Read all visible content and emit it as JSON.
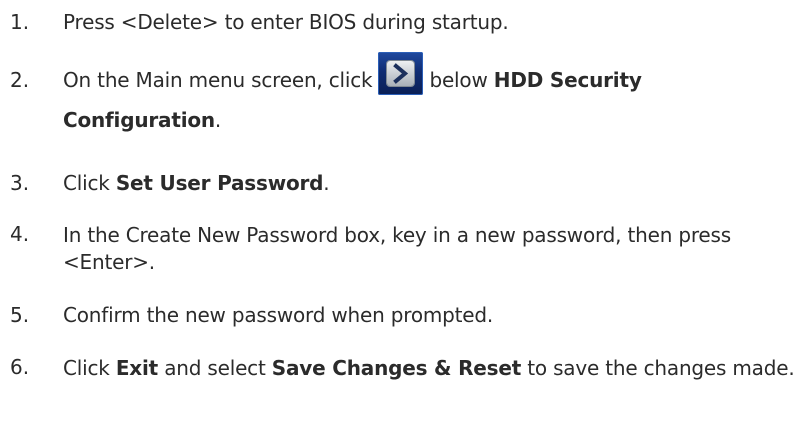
{
  "steps": [
    {
      "number": "1.",
      "parts": [
        "Press <Delete> to enter BIOS during startup."
      ]
    },
    {
      "number": "2.",
      "parts": [
        "On the Main menu screen, click",
        "below",
        "HDD Security Configuration",
        "."
      ],
      "icon": "arrow-right-icon"
    },
    {
      "number": "3.",
      "parts": [
        "Click",
        "Set User Password",
        "."
      ]
    },
    {
      "number": "4.",
      "parts": [
        "In the Create New Password box, key in a new password, then press <Enter>."
      ]
    },
    {
      "number": "5.",
      "parts": [
        "Confirm the new password when prompted."
      ]
    },
    {
      "number": "6.",
      "parts": [
        "Click",
        "Exit",
        "and select",
        "Save Changes & Reset",
        "to save the changes made."
      ]
    }
  ],
  "colors": {
    "text": "#2b2b2b",
    "button_bg": "#0f2c73",
    "button_face": "#c7ccd2"
  }
}
